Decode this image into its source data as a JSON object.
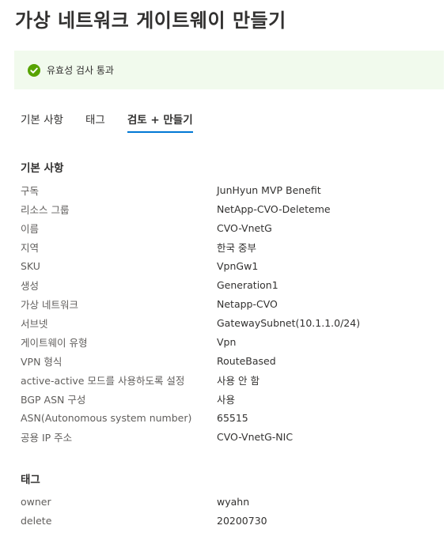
{
  "page": {
    "title": "가상 네트워크 게이트웨이 만들기"
  },
  "validation": {
    "status_text": "유효성 검사 통과",
    "icon": "check-circle-icon",
    "icon_color": "#57a300",
    "background": "#f1faed"
  },
  "tabs": [
    {
      "label": "기본 사항",
      "active": false
    },
    {
      "label": "태그",
      "active": false
    },
    {
      "label": "검토 + 만들기",
      "active": true
    }
  ],
  "accent_color": "#0078d4",
  "basics": {
    "title": "기본 사항",
    "rows": [
      {
        "label": "구독",
        "value": "JunHyun MVP Benefit"
      },
      {
        "label": "리소스 그룹",
        "value": "NetApp-CVO-Deleteme"
      },
      {
        "label": "이름",
        "value": "CVO-VnetG"
      },
      {
        "label": "지역",
        "value": "한국 중부"
      },
      {
        "label": "SKU",
        "value": "VpnGw1"
      },
      {
        "label": "생성",
        "value": "Generation1"
      },
      {
        "label": "가상 네트워크",
        "value": "Netapp-CVO"
      },
      {
        "label": "서브넷",
        "value": "GatewaySubnet(10.1.1.0/24)"
      },
      {
        "label": "게이트웨이 유형",
        "value": "Vpn"
      },
      {
        "label": "VPN 형식",
        "value": "RouteBased"
      },
      {
        "label": "active-active 모드를 사용하도록 설정",
        "value": "사용 안 함"
      },
      {
        "label": "BGP ASN 구성",
        "value": "사용"
      },
      {
        "label": "ASN(Autonomous system number)",
        "value": "65515"
      },
      {
        "label": "공용 IP 주소",
        "value": "CVO-VnetG-NIC"
      }
    ]
  },
  "tags": {
    "title": "태그",
    "rows": [
      {
        "label": "owner",
        "value": "wyahn"
      },
      {
        "label": "delete",
        "value": "20200730"
      }
    ]
  }
}
